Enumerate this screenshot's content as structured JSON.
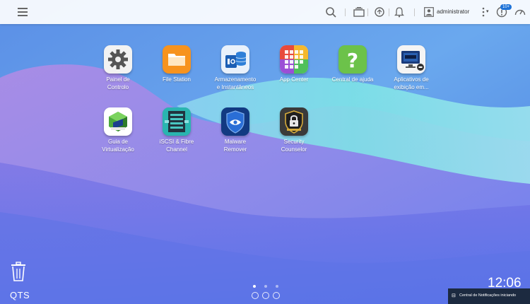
{
  "topbar": {
    "username": "administrator",
    "notification_count": "10+"
  },
  "apps": [
    {
      "label": "Painel de\nControlo",
      "icon": "gear-icon"
    },
    {
      "label": "File Station",
      "icon": "folder-icon"
    },
    {
      "label": "Armazenamento\ne Instantâneos",
      "icon": "storage-icon"
    },
    {
      "label": "App Center",
      "icon": "app-grid-icon"
    },
    {
      "label": "Central de ajuda",
      "icon": "question-icon"
    },
    {
      "label": "Aplicativos de\nexibição em...",
      "icon": "hdmi-monitor-icon"
    },
    {
      "label": "Guia de\nVirtualização",
      "icon": "virtualization-cube-icon"
    },
    {
      "label": "iSCSI & Fibre\nChannel",
      "icon": "iscsi-icon"
    },
    {
      "label": "Malware\nRemover",
      "icon": "shield-icon"
    },
    {
      "label": "Security\nCounselor",
      "icon": "lock-shield-icon"
    }
  ],
  "desktop": {
    "brand": "QTS",
    "clock": "12:06"
  },
  "notification_toast": {
    "text": "Central de Notificações iniciando"
  }
}
